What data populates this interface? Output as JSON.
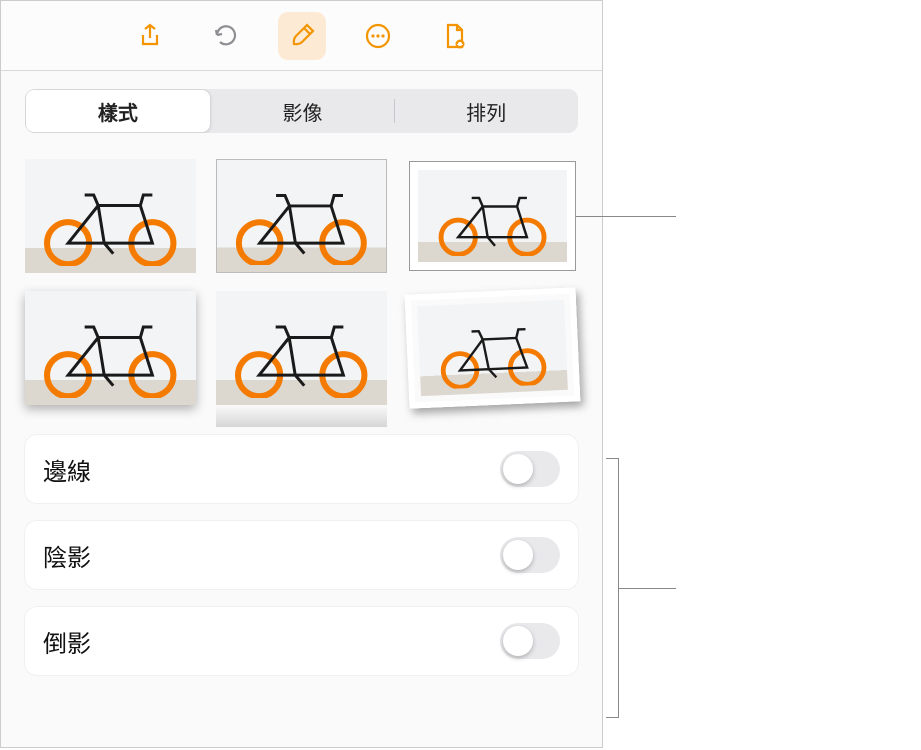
{
  "toolbar": {
    "share_icon": "share-icon",
    "undo_icon": "undo-icon",
    "format_icon": "paintbrush-icon",
    "more_icon": "more-icon",
    "document_icon": "document-view-icon"
  },
  "tabs": {
    "style": "樣式",
    "image": "影像",
    "arrange": "排列"
  },
  "styles": [
    {
      "name": "style-plain"
    },
    {
      "name": "style-thin-border"
    },
    {
      "name": "style-frame"
    },
    {
      "name": "style-shadow"
    },
    {
      "name": "style-reflection"
    },
    {
      "name": "style-tilted-photo"
    }
  ],
  "options": {
    "border": {
      "label": "邊線",
      "value": false
    },
    "shadow": {
      "label": "陰影",
      "value": false
    },
    "reflection": {
      "label": "倒影",
      "value": false
    }
  }
}
